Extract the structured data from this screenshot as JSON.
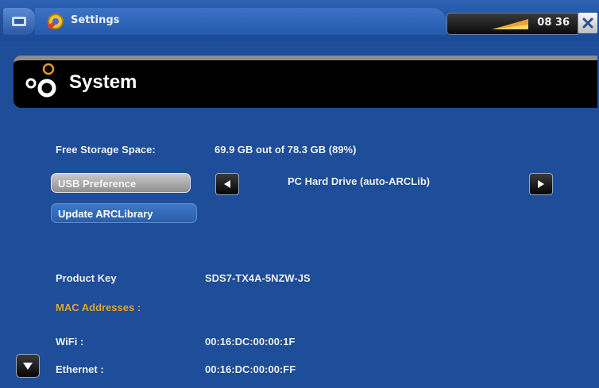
{
  "app": {
    "title": "Settings",
    "time": "08 36",
    "icons": {
      "menu": "menu-icon",
      "app": "settings-icon",
      "close": "close-icon",
      "signal": "signal-icon"
    }
  },
  "section": {
    "title": "System",
    "icon": "gears-icon"
  },
  "storage": {
    "label": "Free Storage Space:",
    "value": "69.9 GB out of 78.3 GB (89%)"
  },
  "usb": {
    "button_label": "USB Preference",
    "value": "PC Hard Drive (auto-ARCLib)"
  },
  "update_button": "Update ARCLibrary",
  "product_key": {
    "label": "Product Key",
    "value": "SDS7-TX4A-5NZW-JS"
  },
  "mac": {
    "heading": "MAC Addresses :",
    "wifi": {
      "label": "WiFi :",
      "value": "00:16:DC:00:00:1F"
    },
    "ethernet": {
      "label": "Ethernet :",
      "value": "00:16:DC:00:00:FF"
    }
  },
  "colors": {
    "background": "#1e4e9a",
    "accent": "#e2a93a",
    "header": "#000000"
  }
}
